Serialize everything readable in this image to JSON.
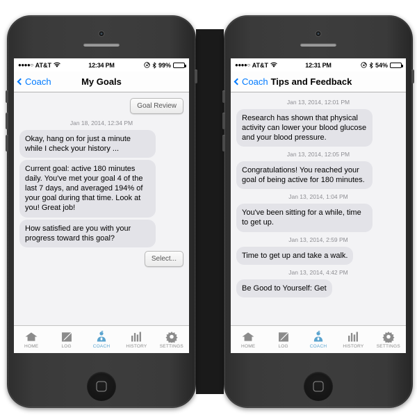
{
  "phones": [
    {
      "id": "left",
      "statusbar": {
        "signal_dots": "●●●●○",
        "carrier": "AT&T",
        "wifi_icon": "wifi-icon",
        "time": "12:34 PM",
        "rotation_lock_icon": "rotation-lock-icon",
        "bluetooth_icon": "bluetooth-icon",
        "battery_pct": "99%",
        "battery_level": 99
      },
      "navbar": {
        "back_label": "Coach",
        "back_icon": "chevron-left-icon",
        "title": "My Goals",
        "title_centered": true
      },
      "items": [
        {
          "type": "action",
          "align": "right",
          "label": "Goal Review",
          "name": "goal-review-button"
        },
        {
          "type": "timestamp",
          "text": "Jan 18, 2014, 12:34 PM"
        },
        {
          "type": "bubble",
          "align": "left",
          "text": "Okay, hang on for just a minute while I check your history ..."
        },
        {
          "type": "bubble",
          "align": "left",
          "text": "Current goal: active 180 minutes daily. You've met your goal 4 of the last 7 days, and averaged 194% of your goal during that time. Look at you! Great job!"
        },
        {
          "type": "bubble",
          "align": "left",
          "text": "How satisfied are you with your progress toward this goal?"
        },
        {
          "type": "action",
          "align": "right",
          "label": "Select...",
          "name": "select-button"
        }
      ],
      "tabs": [
        {
          "label": "HOME",
          "icon": "home-icon",
          "active": false
        },
        {
          "label": "LOG",
          "icon": "log-pencil-icon",
          "active": false
        },
        {
          "label": "COACH",
          "icon": "coach-person-icon",
          "active": true
        },
        {
          "label": "HISTORY",
          "icon": "bar-chart-icon",
          "active": false
        },
        {
          "label": "SETTINGS",
          "icon": "gear-icon",
          "active": false
        }
      ]
    },
    {
      "id": "right",
      "statusbar": {
        "signal_dots": "●●●●○",
        "carrier": "AT&T",
        "wifi_icon": "wifi-icon",
        "time": "12:31 PM",
        "rotation_lock_icon": "rotation-lock-icon",
        "bluetooth_icon": "bluetooth-icon",
        "battery_pct": "54%",
        "battery_level": 54
      },
      "navbar": {
        "back_label": "Coach",
        "back_icon": "chevron-left-icon",
        "title": "Tips and Feedback",
        "title_centered": false
      },
      "items": [
        {
          "type": "timestamp",
          "text": "Jan 13, 2014, 12:01 PM"
        },
        {
          "type": "bubble",
          "align": "left",
          "text": "Research has shown that physical activity can lower your blood glucose and your blood pressure."
        },
        {
          "type": "timestamp",
          "text": "Jan 13, 2014, 12:05 PM"
        },
        {
          "type": "bubble",
          "align": "left",
          "text": "Congratulations! You reached your goal of being active for 180 minutes."
        },
        {
          "type": "timestamp",
          "text": "Jan 13, 2014, 1:04 PM"
        },
        {
          "type": "bubble",
          "align": "left",
          "text": "You've been sitting for a while, time to get up."
        },
        {
          "type": "timestamp",
          "text": "Jan 13, 2014, 2:59 PM"
        },
        {
          "type": "bubble",
          "align": "left",
          "text": "Time to get up and take a walk."
        },
        {
          "type": "timestamp",
          "text": "Jan 13, 2014, 4:42 PM"
        },
        {
          "type": "bubble",
          "align": "left",
          "text": "Be Good to Yourself: Get"
        }
      ],
      "tabs": [
        {
          "label": "HOME",
          "icon": "home-icon",
          "active": false
        },
        {
          "label": "LOG",
          "icon": "log-pencil-icon",
          "active": false
        },
        {
          "label": "COACH",
          "icon": "coach-person-icon",
          "active": true
        },
        {
          "label": "HISTORY",
          "icon": "bar-chart-icon",
          "active": false
        },
        {
          "label": "SETTINGS",
          "icon": "gear-icon",
          "active": false
        }
      ]
    }
  ],
  "colors": {
    "accent_blue": "#007aff",
    "tab_active": "#5ba4cf",
    "bubble_bg": "#e3e3e8",
    "screen_bg": "#f3f3f5",
    "timestamp_gray": "#8e8e93",
    "bezel": "#3d3d3d"
  }
}
